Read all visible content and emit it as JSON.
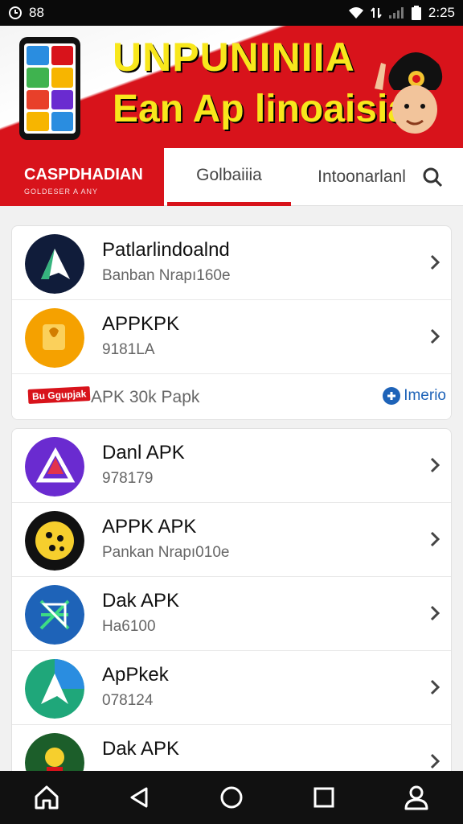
{
  "status_bar": {
    "left_badge": "88",
    "time": "2:25"
  },
  "banner": {
    "title": "UNPUNINIIA",
    "subtitle": "Ean Ap linoaisia"
  },
  "brand": {
    "title": "CASPDHADIAN",
    "subtitle": "GOLDESER A ANY"
  },
  "tabs": [
    {
      "label": "Golbaiiia",
      "active": true
    },
    {
      "label": "Intoonarlanl",
      "active": false
    }
  ],
  "card1": {
    "apps": [
      {
        "name": "Patlarlindoalnd",
        "meta": "Banban Nrapı160e",
        "icon": "dark-triangle-icon"
      },
      {
        "name": "APPKPK",
        "meta": "9181LA",
        "icon": "yellow-puzzle-icon"
      }
    ],
    "ad": {
      "badge": "Bu Ggupjak",
      "text": "APK 30k Papk",
      "sponsor": "Imerio"
    }
  },
  "card2": {
    "apps": [
      {
        "name": "Danl APK",
        "meta": "978179",
        "icon": "purple-triangle-icon"
      },
      {
        "name": "APPK APK",
        "meta": "Pankan Nrapı010e",
        "icon": "black-cookie-icon"
      },
      {
        "name": "Dak APK",
        "meta": "Ha6100",
        "icon": "blue-star-icon"
      },
      {
        "name": "ApPkek",
        "meta": "078124",
        "icon": "blue-green-triangle-icon"
      },
      {
        "name": "Dak APK",
        "meta": "",
        "icon": "green-figure-icon"
      }
    ]
  },
  "colors": {
    "accent": "#d8131b",
    "banner_text": "#f8e71c"
  }
}
